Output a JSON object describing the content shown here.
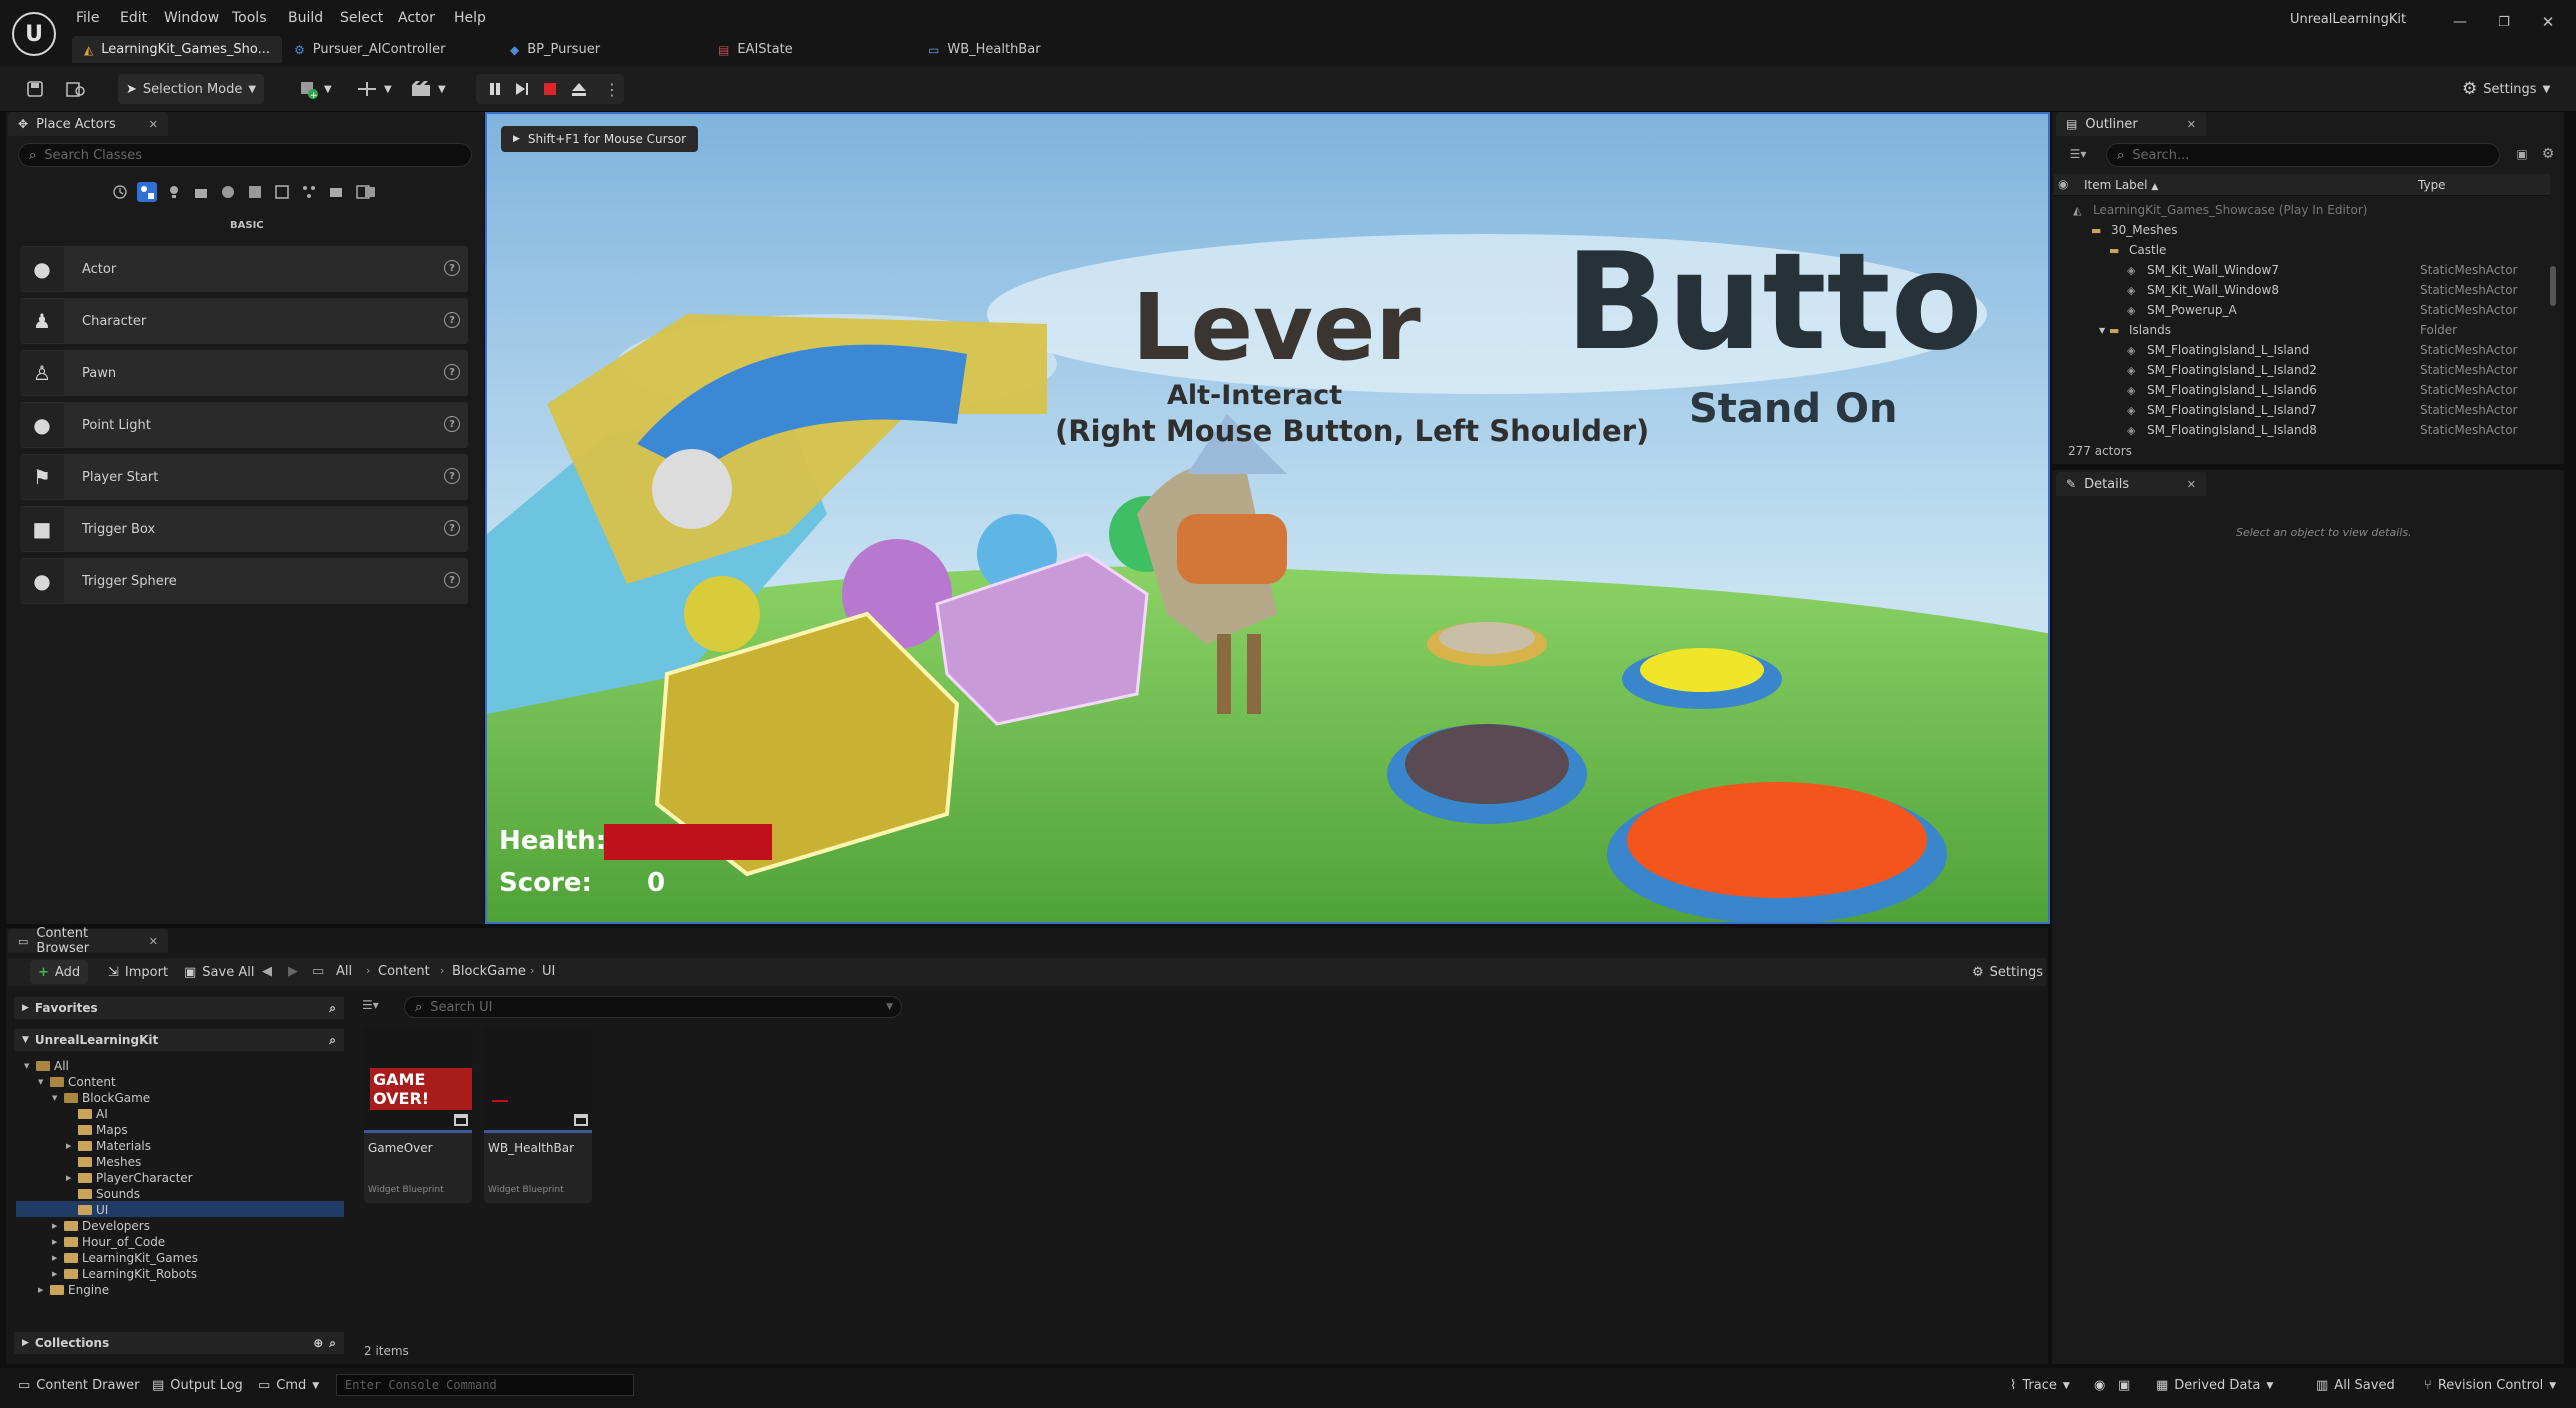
{
  "app": {
    "title": "UnrealLearningKit"
  },
  "menu": [
    "File",
    "Edit",
    "Window",
    "Tools",
    "Build",
    "Select",
    "Actor",
    "Help"
  ],
  "tabs": [
    {
      "label": "LearningKit_Games_Sho...",
      "active": true
    },
    {
      "label": "Pursuer_AIController",
      "active": false
    },
    {
      "label": "BP_Pursuer",
      "active": false
    },
    {
      "label": "EAIState",
      "active": false
    },
    {
      "label": "WB_HealthBar",
      "active": false
    }
  ],
  "toolbar": {
    "mode_label": "Selection Mode",
    "settings_label": "Settings"
  },
  "place_actors": {
    "tab_label": "Place Actors",
    "search_placeholder": "Search Classes",
    "category": "BASIC",
    "items": [
      {
        "label": "Actor",
        "icon": "sphere-icon"
      },
      {
        "label": "Character",
        "icon": "character-icon"
      },
      {
        "label": "Pawn",
        "icon": "pawn-icon"
      },
      {
        "label": "Point Light",
        "icon": "light-bulb-icon"
      },
      {
        "label": "Player Start",
        "icon": "flag-icon"
      },
      {
        "label": "Trigger Box",
        "icon": "cube-icon"
      },
      {
        "label": "Trigger Sphere",
        "icon": "sphere-icon"
      }
    ]
  },
  "viewport": {
    "hint": "Shift+F1 for Mouse Cursor",
    "lever_title": "Lever",
    "lever_sub1": "Alt-Interact",
    "lever_sub2": "(Right Mouse Button, Left Shoulder)",
    "button_title": "Butto",
    "button_sub": "Stand On",
    "health_label": "Health:",
    "health_fraction": 1.0,
    "score_label": "Score:",
    "score_value": "0"
  },
  "outliner": {
    "tab_label": "Outliner",
    "search_placeholder": "Search...",
    "col_label": "Item Label",
    "col_type": "Type",
    "rows": [
      {
        "label": "LearningKit_Games_Showcase (Play In Editor)",
        "type": "",
        "depth": 0,
        "kind": "world"
      },
      {
        "label": "30_Meshes",
        "type": "",
        "depth": 1,
        "kind": "folder"
      },
      {
        "label": "Castle",
        "type": "",
        "depth": 2,
        "kind": "folder"
      },
      {
        "label": "SM_Kit_Wall_Window7",
        "type": "StaticMeshActor",
        "depth": 3,
        "kind": "mesh"
      },
      {
        "label": "SM_Kit_Wall_Window8",
        "type": "StaticMeshActor",
        "depth": 3,
        "kind": "mesh"
      },
      {
        "label": "SM_Powerup_A",
        "type": "StaticMeshActor",
        "depth": 3,
        "kind": "mesh"
      },
      {
        "label": "Islands",
        "type": "Folder",
        "depth": 2,
        "kind": "folder"
      },
      {
        "label": "SM_FloatingIsland_L_Island",
        "type": "StaticMeshActor",
        "depth": 3,
        "kind": "mesh"
      },
      {
        "label": "SM_FloatingIsland_L_Island2",
        "type": "StaticMeshActor",
        "depth": 3,
        "kind": "mesh"
      },
      {
        "label": "SM_FloatingIsland_L_Island6",
        "type": "StaticMeshActor",
        "depth": 3,
        "kind": "mesh"
      },
      {
        "label": "SM_FloatingIsland_L_Island7",
        "type": "StaticMeshActor",
        "depth": 3,
        "kind": "mesh"
      },
      {
        "label": "SM_FloatingIsland_L_Island8",
        "type": "StaticMeshActor",
        "depth": 3,
        "kind": "mesh"
      }
    ],
    "count": "277 actors"
  },
  "details": {
    "tab_label": "Details",
    "empty_text": "Select an object to view details."
  },
  "content_browser": {
    "tab_label": "Content Browser",
    "add_label": "Add",
    "import_label": "Import",
    "saveall_label": "Save All",
    "breadcrumb": [
      "All",
      "Content",
      "BlockGame",
      "UI"
    ],
    "settings_label": "Settings",
    "search_placeholder": "Search UI",
    "favorites_label": "Favorites",
    "project_label": "UnrealLearningKit",
    "collections_label": "Collections",
    "tree": [
      {
        "label": "All",
        "depth": 0
      },
      {
        "label": "Content",
        "depth": 1
      },
      {
        "label": "BlockGame",
        "depth": 2
      },
      {
        "label": "AI",
        "depth": 3
      },
      {
        "label": "Maps",
        "depth": 3
      },
      {
        "label": "Materials",
        "depth": 3
      },
      {
        "label": "Meshes",
        "depth": 3
      },
      {
        "label": "PlayerCharacter",
        "depth": 3
      },
      {
        "label": "Sounds",
        "depth": 3
      },
      {
        "label": "UI",
        "depth": 3
      },
      {
        "label": "Developers",
        "depth": 2
      },
      {
        "label": "Hour_of_Code",
        "depth": 2
      },
      {
        "label": "LearningKit_Games",
        "depth": 2
      },
      {
        "label": "LearningKit_Robots",
        "depth": 2
      },
      {
        "label": "Engine",
        "depth": 1
      }
    ],
    "assets": [
      {
        "name": "GameOver",
        "type": "Widget Blueprint",
        "thumb_text": "GAME OVER!"
      },
      {
        "name": "WB_HealthBar",
        "type": "Widget Blueprint",
        "thumb_text": ""
      }
    ],
    "item_count": "2 items"
  },
  "statusbar": {
    "content_drawer": "Content Drawer",
    "output_log": "Output Log",
    "cmd": "Cmd",
    "console_placeholder": "Enter Console Command",
    "trace": "Trace",
    "derived_data": "Derived Data",
    "all_saved": "All Saved",
    "revision_control": "Revision Control"
  },
  "colors": {
    "accent": "#3a70c8",
    "health": "#c0101a",
    "folder": "#c9a45a"
  }
}
